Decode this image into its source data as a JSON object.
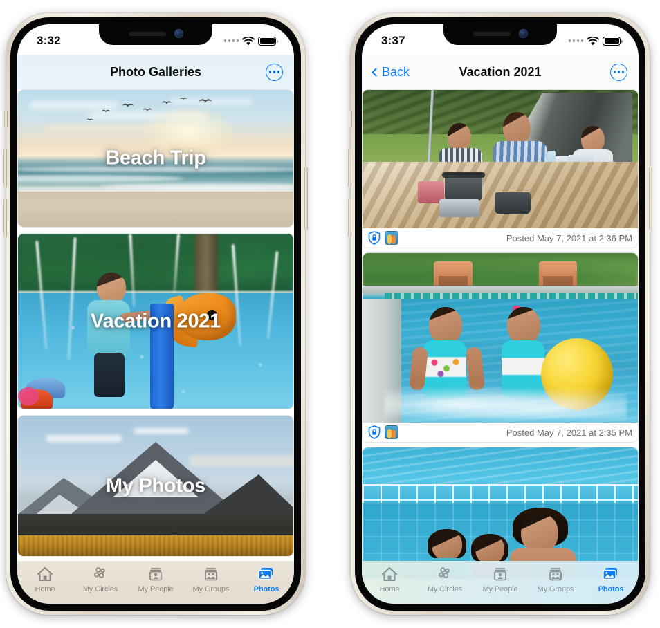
{
  "left_phone": {
    "status_bar": {
      "time": "3:32",
      "signal_icon": "signal-dots-icon",
      "wifi_icon": "wifi-icon",
      "battery_icon": "battery-full-icon"
    },
    "nav": {
      "title": "Photo Galleries",
      "more_button_label": "•••",
      "more_icon": "ellipsis-circle-icon"
    },
    "galleries": [
      {
        "title": "Beach Trip",
        "scene": "beach-sunset"
      },
      {
        "title": "Vacation 2021",
        "scene": "splash-pad"
      },
      {
        "title": "My Photos",
        "scene": "mountain"
      }
    ],
    "tabs": [
      {
        "label": "Home",
        "icon": "home-icon",
        "active": false
      },
      {
        "label": "My Circles",
        "icon": "circles-icon",
        "active": false
      },
      {
        "label": "My People",
        "icon": "person-card-icon",
        "active": false
      },
      {
        "label": "My Groups",
        "icon": "group-card-icon",
        "active": false
      },
      {
        "label": "Photos",
        "icon": "photos-icon",
        "active": true
      }
    ]
  },
  "right_phone": {
    "status_bar": {
      "time": "3:37",
      "signal_icon": "signal-dots-icon",
      "wifi_icon": "wifi-icon",
      "battery_icon": "battery-full-icon"
    },
    "nav": {
      "back_label": "Back",
      "back_icon": "chevron-left-icon",
      "title": "Vacation 2021",
      "more_button_label": "•••",
      "more_icon": "ellipsis-circle-icon"
    },
    "photos": [
      {
        "scene": "camping-family",
        "posted": "Posted May 7, 2021 at 2:36 PM",
        "lock_icon": "shield-lock-icon",
        "avatar_icon": "photo-thumbnail-avatar"
      },
      {
        "scene": "pool-girls-ball",
        "posted": "Posted May 7, 2021 at 2:35 PM",
        "lock_icon": "shield-lock-icon",
        "avatar_icon": "photo-thumbnail-avatar"
      },
      {
        "scene": "pool-dad-kids",
        "posted": "",
        "lock_icon": "",
        "avatar_icon": ""
      }
    ],
    "tabs": [
      {
        "label": "Home",
        "icon": "home-icon",
        "active": false
      },
      {
        "label": "My Circles",
        "icon": "circles-icon",
        "active": false
      },
      {
        "label": "My People",
        "icon": "person-card-icon",
        "active": false
      },
      {
        "label": "My Groups",
        "icon": "group-card-icon",
        "active": false
      },
      {
        "label": "Photos",
        "icon": "photos-icon",
        "active": true
      }
    ]
  },
  "colors": {
    "accent_blue": "#0a7cff",
    "tab_inactive": "#8d8980",
    "meta_text": "#6f6f72",
    "frame_gold": "#e8e1d4"
  }
}
